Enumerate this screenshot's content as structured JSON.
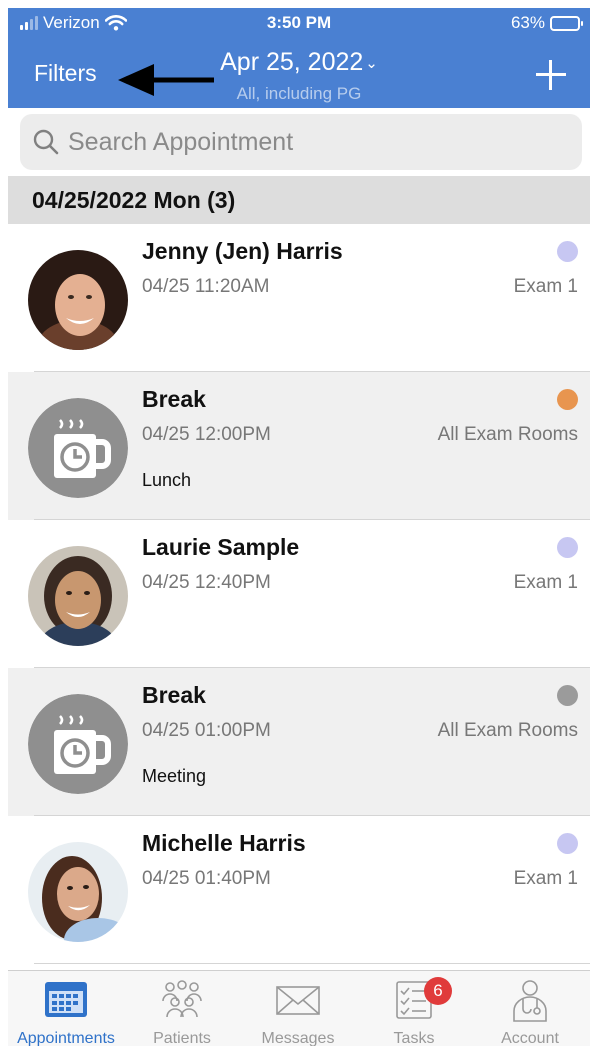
{
  "status_bar": {
    "carrier": "Verizon",
    "time": "3:50 PM",
    "battery": "63%"
  },
  "nav": {
    "filters_label": "Filters",
    "date_title": "Apr 25, 2022",
    "chevron": "⌄",
    "subtitle": "All, including PG"
  },
  "search": {
    "placeholder": "Search Appointment"
  },
  "day_header": "04/25/2022 Mon (3)",
  "appointments": [
    {
      "name": "Jenny (Jen) Harris",
      "time": "04/25 11:20AM",
      "room": "Exam 1",
      "note": "",
      "status_color": "#c7c7f2",
      "type": "patient"
    },
    {
      "name": "Break",
      "time": "04/25 12:00PM",
      "room": "All Exam Rooms",
      "note": "Lunch",
      "status_color": "#e8954f",
      "type": "break"
    },
    {
      "name": "Laurie Sample",
      "time": "04/25 12:40PM",
      "room": "Exam 1",
      "note": "",
      "status_color": "#c7c7f2",
      "type": "patient"
    },
    {
      "name": "Break",
      "time": "04/25 01:00PM",
      "room": "All Exam Rooms",
      "note": "Meeting",
      "status_color": "#9b9b9b",
      "type": "break"
    },
    {
      "name": "Michelle Harris",
      "time": "04/25 01:40PM",
      "room": "Exam 1",
      "note": "",
      "status_color": "#c7c7f2",
      "type": "patient"
    }
  ],
  "tabs": [
    {
      "label": "Appointments",
      "icon": "calendar-icon",
      "active": true
    },
    {
      "label": "Patients",
      "icon": "patients-icon",
      "active": false
    },
    {
      "label": "Messages",
      "icon": "envelope-icon",
      "active": false
    },
    {
      "label": "Tasks",
      "icon": "checklist-icon",
      "active": false,
      "badge": "6"
    },
    {
      "label": "Account",
      "icon": "doctor-icon",
      "active": false
    }
  ],
  "colors": {
    "header": "#4a80d2",
    "accent": "#2f72c9",
    "badge": "#e03b3b"
  }
}
